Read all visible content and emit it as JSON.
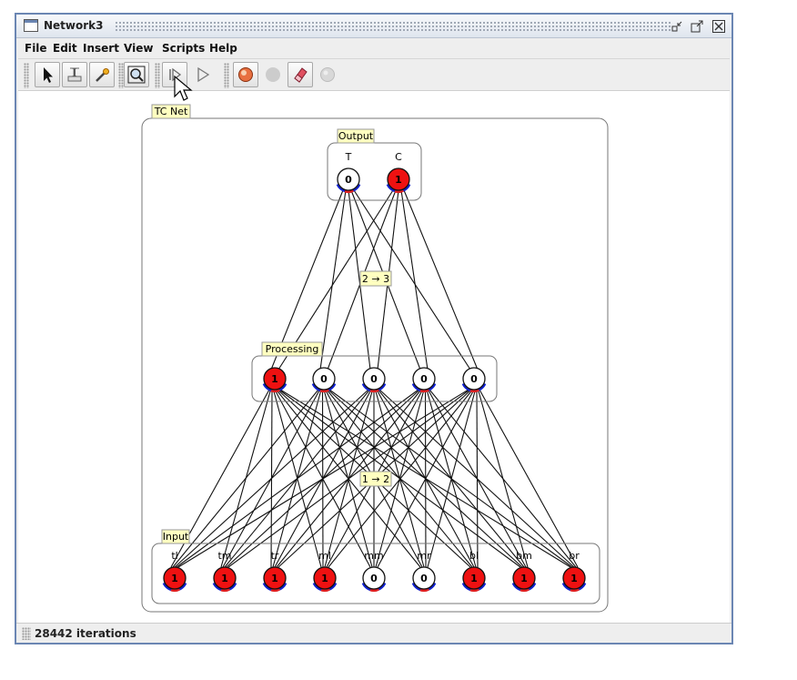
{
  "window": {
    "title": "Network3"
  },
  "menu": {
    "items": [
      "File",
      "Edit",
      "Insert",
      "View",
      "Scripts",
      "Help"
    ]
  },
  "toolbar": {
    "buttons": [
      "select-arrow-icon",
      "edit-text-icon",
      "wand-icon",
      "zoom-icon",
      "step-icon",
      "play-icon",
      "randomize-icon",
      "stop-circle-icon",
      "eraser-icon",
      "clear-icon"
    ]
  },
  "network": {
    "group_label": "TC Net",
    "output": {
      "label": "Output",
      "neurons": [
        {
          "label": "T",
          "value": "0",
          "active": false
        },
        {
          "label": "C",
          "value": "1",
          "active": true
        }
      ]
    },
    "processing": {
      "label": "Processing",
      "neurons": [
        {
          "value": "1",
          "active": true
        },
        {
          "value": "0",
          "active": false
        },
        {
          "value": "0",
          "active": false
        },
        {
          "value": "0",
          "active": false
        },
        {
          "value": "0",
          "active": false
        }
      ]
    },
    "input": {
      "label": "Input",
      "neurons": [
        {
          "label": "tl",
          "value": "1",
          "active": true
        },
        {
          "label": "tm",
          "value": "1",
          "active": true
        },
        {
          "label": "tr",
          "value": "1",
          "active": true
        },
        {
          "label": "ml",
          "value": "1",
          "active": true
        },
        {
          "label": "mm",
          "value": "0",
          "active": false
        },
        {
          "label": "mr",
          "value": "0",
          "active": false
        },
        {
          "label": "bl",
          "value": "1",
          "active": true
        },
        {
          "label": "bm",
          "value": "1",
          "active": true
        },
        {
          "label": "br",
          "value": "1",
          "active": true
        }
      ]
    },
    "synapse_groups": [
      {
        "label": "2 → 3"
      },
      {
        "label": "1 → 2"
      }
    ],
    "colors": {
      "active": "#ee1111",
      "inactive": "#ffffff",
      "inhibit": "#1020d0",
      "excite": "#e02020",
      "label_bg": "#ffffc0"
    }
  },
  "status": {
    "text": "28442 iterations"
  }
}
